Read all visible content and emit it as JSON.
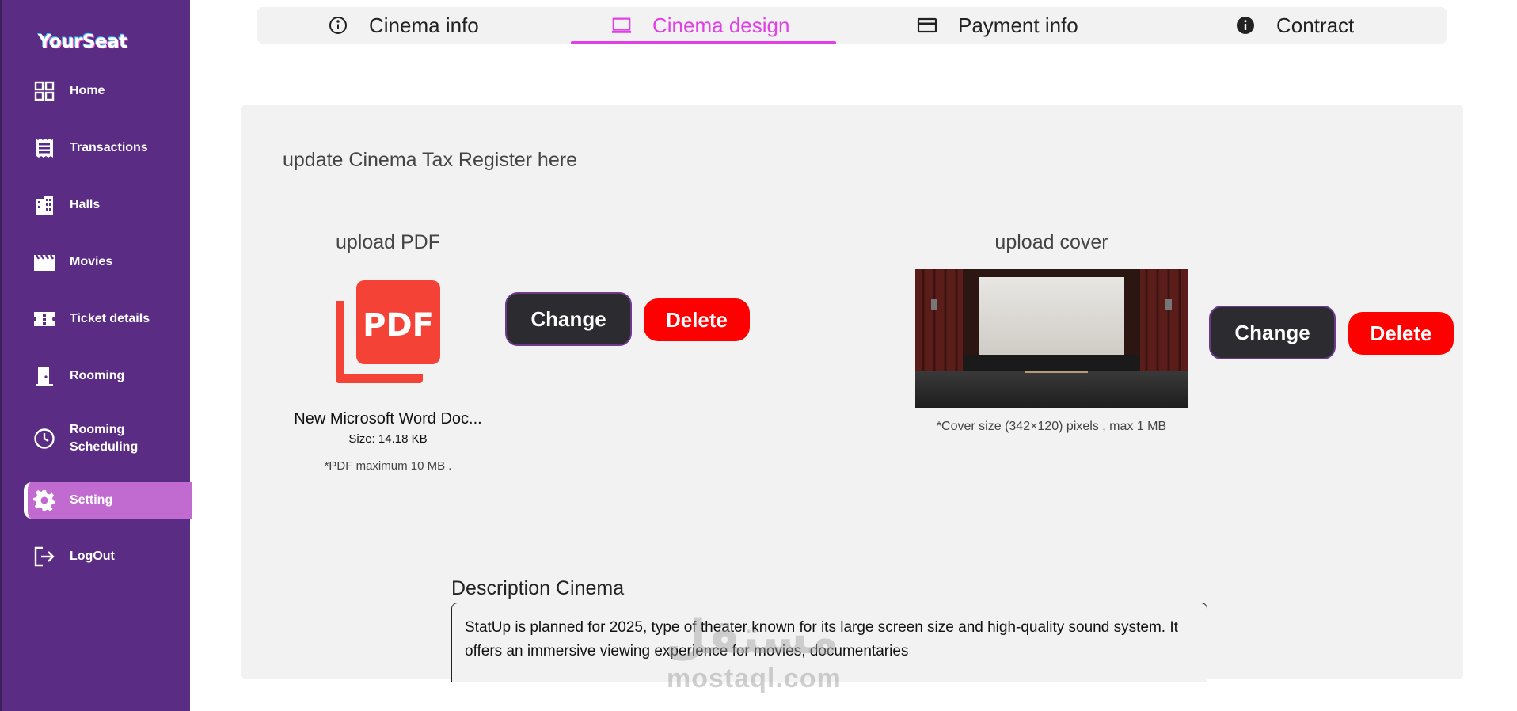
{
  "app": {
    "logo": "YourSeat"
  },
  "sidebar": {
    "items": [
      {
        "label": "Home",
        "icon": "grid-icon"
      },
      {
        "label": "Transactions",
        "icon": "receipt-icon"
      },
      {
        "label": "Halls",
        "icon": "building-icon"
      },
      {
        "label": "Movies",
        "icon": "clapperboard-icon"
      },
      {
        "label": "Ticket details",
        "icon": "ticket-icon"
      },
      {
        "label": "Rooming",
        "icon": "door-icon"
      },
      {
        "label": "Rooming Scheduling",
        "icon": "clock-icon"
      },
      {
        "label": "Setting",
        "icon": "gear-icon",
        "active": true
      },
      {
        "label": "LogOut",
        "icon": "logout-icon"
      }
    ]
  },
  "tabs": [
    {
      "label": "Cinema info",
      "icon": "info-outline-icon"
    },
    {
      "label": "Cinema design",
      "icon": "laptop-icon",
      "active": true
    },
    {
      "label": "Payment info",
      "icon": "credit-card-icon"
    },
    {
      "label": "Contract",
      "icon": "info-filled-icon"
    }
  ],
  "main": {
    "section_title": "update Cinema Tax Register here",
    "pdf": {
      "label": "upload PDF",
      "icon_text": "PDF",
      "file_name": "New Microsoft Word Doc...",
      "file_size": "Size: 14.18 KB",
      "note": "*PDF maximum 10 MB .",
      "change_label": "Change",
      "delete_label": "Delete"
    },
    "cover": {
      "label": "upload cover",
      "note": "*Cover size (342×120) pixels , max 1 MB",
      "change_label": "Change",
      "delete_label": "Delete"
    },
    "description": {
      "label": "Description Cinema",
      "text": "StatUp is planned for 2025, type of theater known for its large screen size and high-quality sound system. It offers an immersive viewing experience for movies, documentaries"
    }
  },
  "watermark": {
    "arabic": "مستقل",
    "latin": "mostaql.com"
  },
  "colors": {
    "sidebar_bg": "#5b2c83",
    "active_item_bg": "#c16ad0",
    "accent": "#e040e6",
    "delete_red": "#ff0000",
    "change_dark": "#2b2b30",
    "panel_bg": "#f2f2f2"
  }
}
